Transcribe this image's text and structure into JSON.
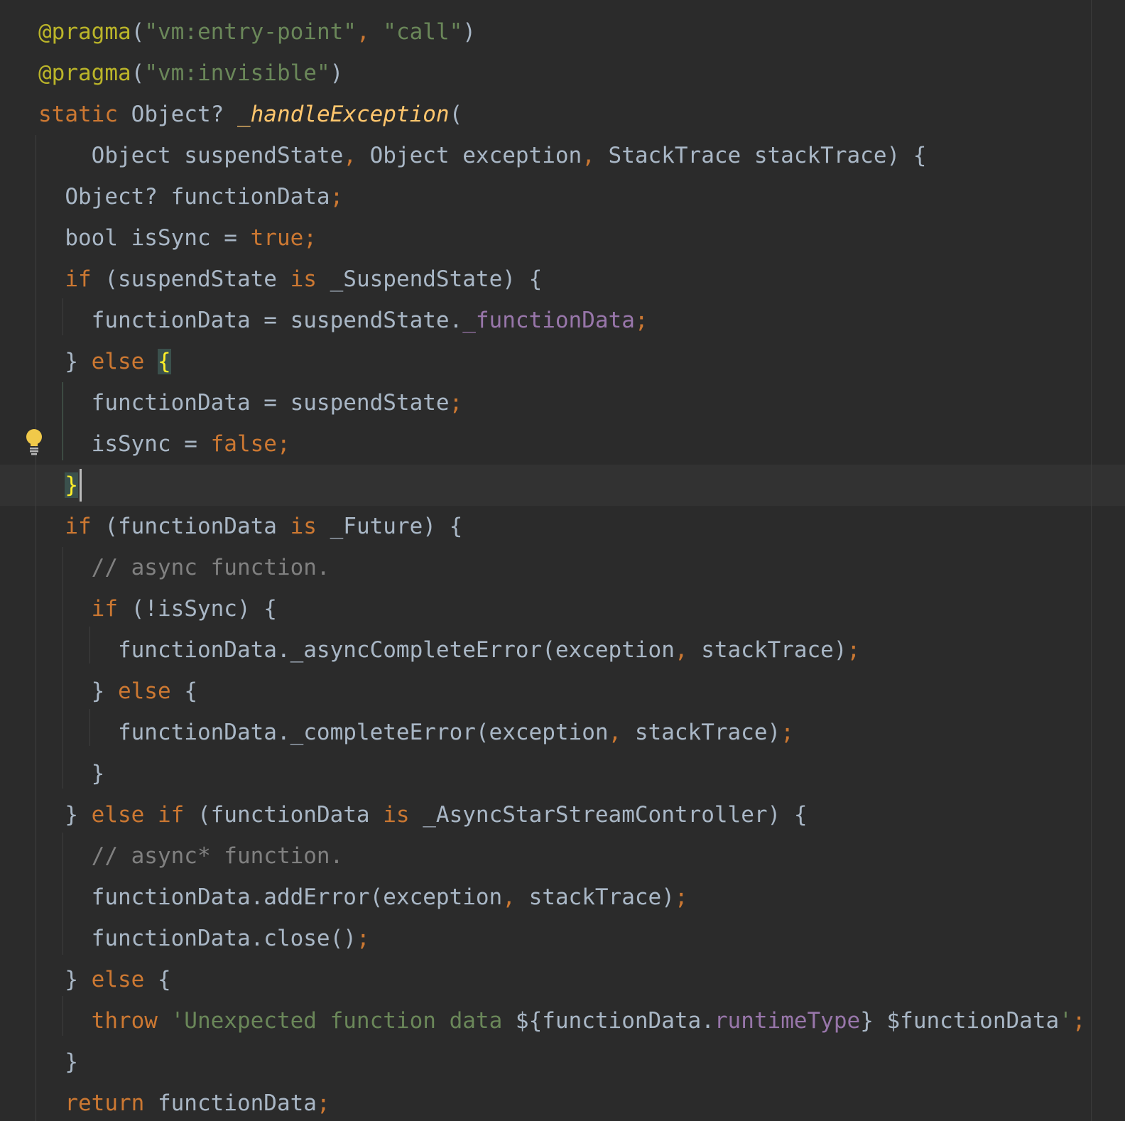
{
  "editor": {
    "language": "Dart",
    "theme_colors": {
      "background": "#2b2b2b",
      "text": "#a9b7c6",
      "keyword": "#cc7832",
      "annotation": "#bbb529",
      "string": "#6a8759",
      "function_declaration": "#ffc66d",
      "field": "#9876aa",
      "comment": "#808080",
      "brace_match": "#ffef28"
    },
    "gutter_icon": "lightbulb-icon",
    "lines": [
      [
        [
          "ann",
          "@pragma"
        ],
        [
          "plain",
          "("
        ],
        [
          "str",
          "\"vm:entry-point\""
        ],
        [
          "kw",
          ", "
        ],
        [
          "str",
          "\"call\""
        ],
        [
          "plain",
          ")"
        ]
      ],
      [
        [
          "ann",
          "@pragma"
        ],
        [
          "plain",
          "("
        ],
        [
          "str",
          "\"vm:invisible\""
        ],
        [
          "plain",
          ")"
        ]
      ],
      [
        [
          "kw",
          "static "
        ],
        [
          "plain",
          "Object? "
        ],
        [
          "fn",
          "_handleException"
        ],
        [
          "plain",
          "("
        ]
      ],
      [
        [
          "plain",
          "    Object suspendState"
        ],
        [
          "kw",
          ", "
        ],
        [
          "plain",
          "Object exception"
        ],
        [
          "kw",
          ", "
        ],
        [
          "plain",
          "StackTrace stackTrace) {"
        ]
      ],
      [
        [
          "plain",
          "  Object? functionData"
        ],
        [
          "kw",
          ";"
        ]
      ],
      [
        [
          "plain",
          "  bool isSync = "
        ],
        [
          "kw",
          "true;"
        ]
      ],
      [
        [
          "kw",
          "  if "
        ],
        [
          "plain",
          "(suspendState "
        ],
        [
          "kw",
          "is "
        ],
        [
          "plain",
          "_SuspendState) {"
        ]
      ],
      [
        [
          "plain",
          "    functionData = suspendState."
        ],
        [
          "field",
          "_functionData"
        ],
        [
          "kw",
          ";"
        ]
      ],
      [
        [
          "plain",
          "  } "
        ],
        [
          "kw",
          "else "
        ],
        [
          "brace-hl",
          "{"
        ]
      ],
      [
        [
          "plain",
          "    functionData = suspendState"
        ],
        [
          "kw",
          ";"
        ]
      ],
      [
        [
          "plain",
          "    isSync = "
        ],
        [
          "kw",
          "false;"
        ]
      ],
      [
        [
          "plain",
          "  "
        ],
        [
          "brace-hl",
          "}"
        ]
      ],
      [
        [
          "kw",
          "  if "
        ],
        [
          "plain",
          "(functionData "
        ],
        [
          "kw",
          "is "
        ],
        [
          "plain",
          "_Future) {"
        ]
      ],
      [
        [
          "cmt",
          "    // async function."
        ]
      ],
      [
        [
          "kw",
          "    if "
        ],
        [
          "plain",
          "(!isSync) {"
        ]
      ],
      [
        [
          "plain",
          "      functionData._asyncCompleteError(exception"
        ],
        [
          "kw",
          ", "
        ],
        [
          "plain",
          "stackTrace)"
        ],
        [
          "kw",
          ";"
        ]
      ],
      [
        [
          "plain",
          "    } "
        ],
        [
          "kw",
          "else "
        ],
        [
          "plain",
          "{"
        ]
      ],
      [
        [
          "plain",
          "      functionData._completeError(exception"
        ],
        [
          "kw",
          ", "
        ],
        [
          "plain",
          "stackTrace)"
        ],
        [
          "kw",
          ";"
        ]
      ],
      [
        [
          "plain",
          "    }"
        ]
      ],
      [
        [
          "plain",
          "  } "
        ],
        [
          "kw",
          "else if "
        ],
        [
          "plain",
          "(functionData "
        ],
        [
          "kw",
          "is "
        ],
        [
          "plain",
          "_AsyncStarStreamController) {"
        ]
      ],
      [
        [
          "cmt",
          "    // async* function."
        ]
      ],
      [
        [
          "plain",
          "    functionData.addError(exception"
        ],
        [
          "kw",
          ", "
        ],
        [
          "plain",
          "stackTrace)"
        ],
        [
          "kw",
          ";"
        ]
      ],
      [
        [
          "plain",
          "    functionData.close()"
        ],
        [
          "kw",
          ";"
        ]
      ],
      [
        [
          "plain",
          "  } "
        ],
        [
          "kw",
          "else "
        ],
        [
          "plain",
          "{"
        ]
      ],
      [
        [
          "kw",
          "    throw "
        ],
        [
          "str",
          "'Unexpected function data "
        ],
        [
          "plain",
          "${functionData."
        ],
        [
          "field",
          "runtimeType"
        ],
        [
          "plain",
          "} $functionData"
        ],
        [
          "str",
          "'"
        ],
        [
          "kw",
          ";"
        ]
      ],
      [
        [
          "plain",
          "  }"
        ]
      ],
      [
        [
          "kw",
          "  return "
        ],
        [
          "plain",
          "functionData"
        ],
        [
          "kw",
          ";"
        ]
      ]
    ]
  }
}
